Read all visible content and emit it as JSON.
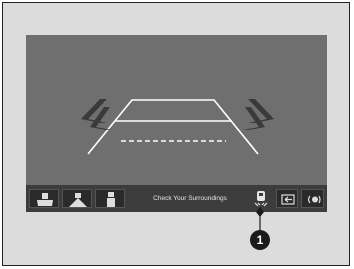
{
  "toolbar": {
    "status_message": "Check Your Surroundings",
    "buttons": [
      {
        "name": "view-normal-button",
        "icon": "top-down-camera-icon"
      },
      {
        "name": "view-wide-button",
        "icon": "wide-view-icon"
      },
      {
        "name": "view-top-button",
        "icon": "top-view-icon"
      },
      {
        "name": "parking-sensor-button",
        "icon": "parking-sensor-icon"
      },
      {
        "name": "back-button",
        "icon": "back-arrow-icon"
      },
      {
        "name": "sensor-toggle-button",
        "icon": "sensor-toggle-icon"
      }
    ]
  },
  "callout": {
    "number": "1"
  },
  "colors": {
    "screen_bg": "#6f6f6f",
    "toolbar_bg": "#3c3c3c",
    "guide_line": "#ffffff",
    "sensor_chevron": "#3a3a3a",
    "callout_bg": "#1a1a1a"
  }
}
